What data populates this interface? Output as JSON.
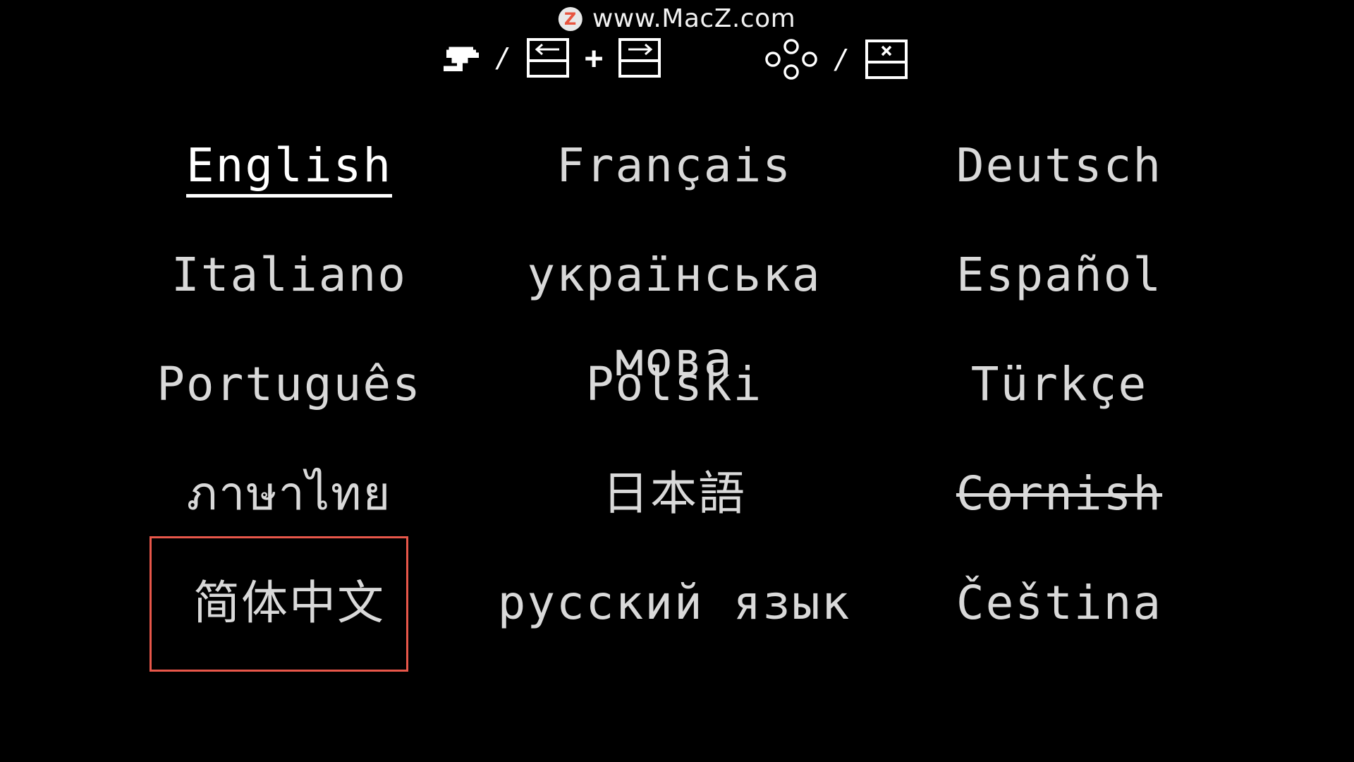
{
  "watermark": {
    "logo_letter": "Z",
    "text": "www.MacZ.com"
  },
  "controls": {
    "left_hint": {
      "icons": [
        "pointing-hand-icon",
        "left-key-icon",
        "right-key-icon"
      ],
      "slash": "/",
      "plus": "+"
    },
    "right_hint": {
      "icons": [
        "dpad-icon",
        "x-key-icon"
      ],
      "slash": "/"
    }
  },
  "languages": {
    "rows": [
      [
        {
          "label": "English",
          "state": "selected"
        },
        {
          "label": "Français",
          "state": "normal"
        },
        {
          "label": "Deutsch",
          "state": "normal"
        }
      ],
      [
        {
          "label": "Italiano",
          "state": "normal"
        },
        {
          "label": "українська мова",
          "state": "normal"
        },
        {
          "label": "Español",
          "state": "normal"
        }
      ],
      [
        {
          "label": "Português",
          "state": "normal"
        },
        {
          "label": "Polski",
          "state": "normal"
        },
        {
          "label": "Türkçe",
          "state": "normal"
        }
      ],
      [
        {
          "label": "ภาษาไทย",
          "state": "normal"
        },
        {
          "label": "日本語",
          "state": "normal"
        },
        {
          "label": "Cornish",
          "state": "struck"
        }
      ],
      [
        {
          "label": "简体中文",
          "state": "highlighted"
        },
        {
          "label": "русский язык",
          "state": "normal"
        },
        {
          "label": "Čeština",
          "state": "normal"
        }
      ]
    ]
  },
  "colors": {
    "background": "#000000",
    "text": "#d9d9d9",
    "selected_text": "#ffffff",
    "highlight_box": "#e8574a"
  }
}
